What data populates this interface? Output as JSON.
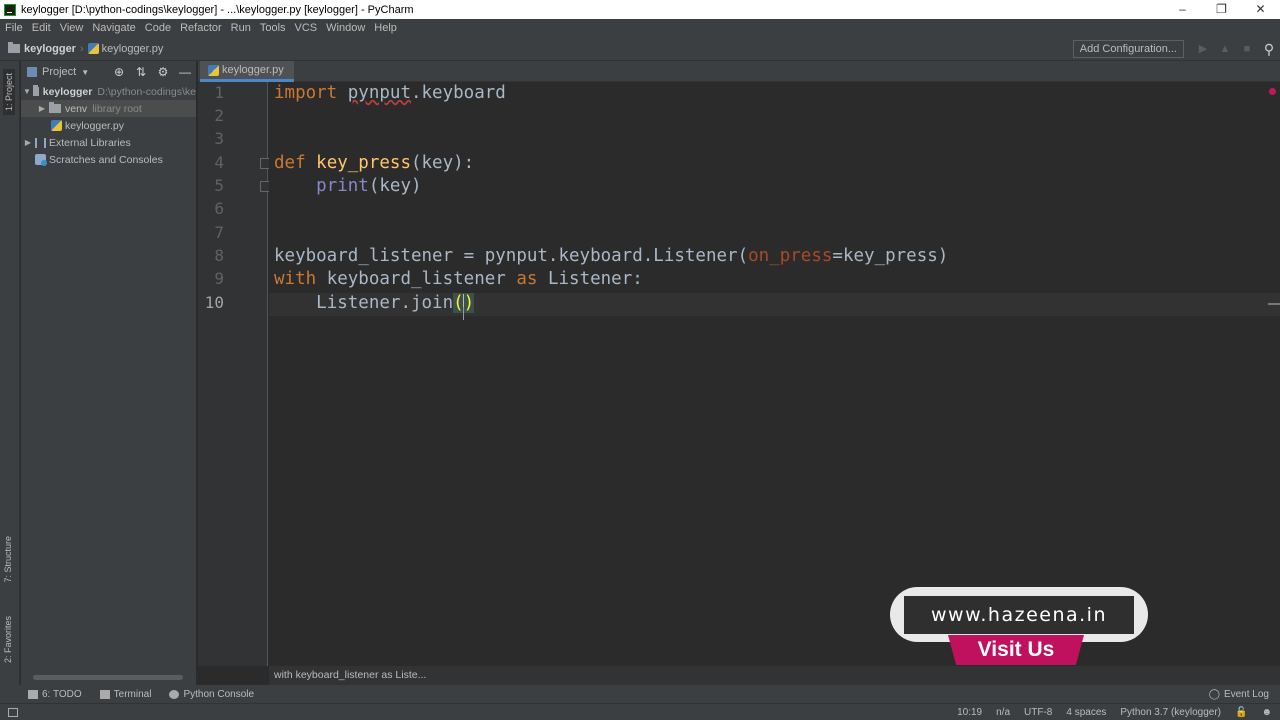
{
  "window": {
    "title": "keylogger [D:\\python-codings\\keylogger] - ...\\keylogger.py [keylogger] - PyCharm",
    "controls": [
      "minimize",
      "restore",
      "close"
    ]
  },
  "menu": [
    "File",
    "Edit",
    "View",
    "Navigate",
    "Code",
    "Refactor",
    "Run",
    "Tools",
    "VCS",
    "Window",
    "Help"
  ],
  "navbar": {
    "project": "keylogger",
    "file": "keylogger.py",
    "add_configuration": "Add Configuration..."
  },
  "left_strip": {
    "project_tab": "1: Project",
    "structure_tab": "7: Structure",
    "favorites_tab": "2: Favorites"
  },
  "project_panel": {
    "header": "Project",
    "tree": [
      {
        "label": "keylogger",
        "hint": "D:\\python-codings\\ke",
        "level": 0,
        "expanded": true,
        "type": "folder"
      },
      {
        "label": "venv",
        "hint": "library root",
        "level": 1,
        "expanded": false,
        "type": "folder"
      },
      {
        "label": "keylogger.py",
        "hint": "",
        "level": 1,
        "type": "python-file"
      },
      {
        "label": "External Libraries",
        "hint": "",
        "level": 0,
        "expanded": false,
        "type": "library"
      },
      {
        "label": "Scratches and Consoles",
        "hint": "",
        "level": 0,
        "type": "scratch"
      }
    ]
  },
  "editor": {
    "tab": "keylogger.py",
    "current_line": 10,
    "line_numbers": [
      "1",
      "2",
      "3",
      "4",
      "5",
      "6",
      "7",
      "8",
      "9",
      "10"
    ],
    "lines": {
      "l1": {
        "kw": "import",
        "mod": "pynput",
        "rest": ".keyboard"
      },
      "l4": {
        "kw": "def",
        "fn": "key_press",
        "rest": "(key):"
      },
      "l5": {
        "builtin": "print",
        "rest": "(key)"
      },
      "l8": {
        "pre": "keyboard_listener = pynput.keyboard.Listener(",
        "param": "on_press",
        "post": "=key_press)"
      },
      "l9": {
        "kw1": "with",
        "mid": " keyboard_listener ",
        "kw2": "as",
        "post": " Listener:"
      },
      "l10": {
        "pre": "Listener.join",
        "open": "(",
        "close": ")"
      }
    },
    "breadcrumb": "with keyboard_listener as Liste..."
  },
  "bottom_toolbar": {
    "todo": "6: TODO",
    "terminal": "Terminal",
    "python_console": "Python Console",
    "event_log": "Event Log"
  },
  "status_bar": {
    "position": "10:19",
    "line_separator": "n/a",
    "encoding": "UTF-8",
    "indent": "4 spaces",
    "interpreter": "Python 3.7 (keylogger)"
  },
  "overlay": {
    "url": "www.hazeena.in",
    "button": "Visit Us",
    "accent_color": "#c0115f"
  }
}
